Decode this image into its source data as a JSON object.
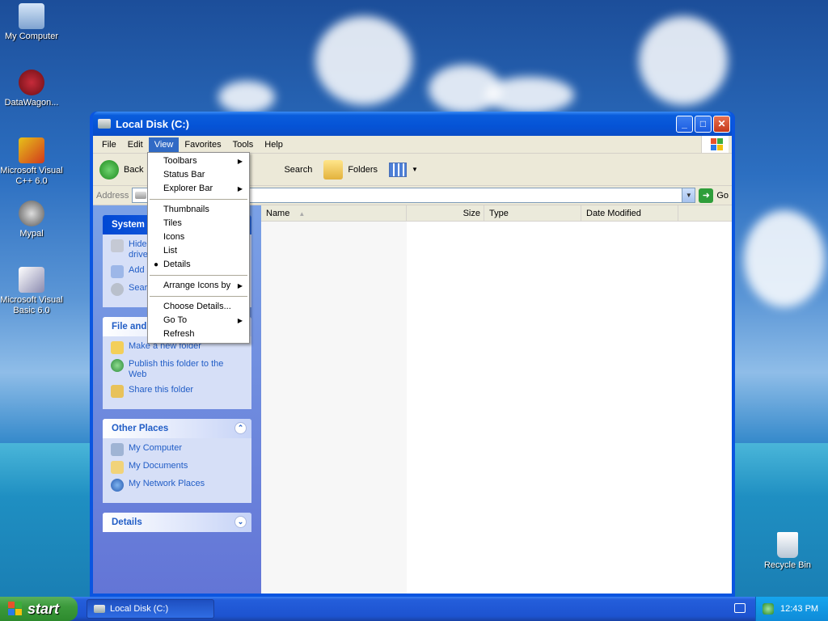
{
  "desktop": {
    "icons": [
      {
        "label": "My Computer",
        "icon": "my-computer-icon"
      },
      {
        "label": "DataWagon...",
        "icon": "datawagon-icon"
      },
      {
        "label": "Microsoft Visual C++ 6.0",
        "icon": "visual-cpp-icon"
      },
      {
        "label": "Mypal",
        "icon": "mypal-icon"
      },
      {
        "label": "Microsoft Visual Basic 6.0",
        "icon": "visual-basic-icon"
      },
      {
        "label": "Recycle Bin",
        "icon": "recycle-bin-icon"
      }
    ]
  },
  "window": {
    "title": "Local Disk (C:)",
    "menu": [
      "File",
      "Edit",
      "View",
      "Favorites",
      "Tools",
      "Help"
    ],
    "toolbar": {
      "back": "Back",
      "search": "Search",
      "folders": "Folders"
    },
    "address": {
      "label": "Address",
      "value": "",
      "go": "Go"
    },
    "view_menu": {
      "toolbars": "Toolbars",
      "status_bar": "Status Bar",
      "explorer_bar": "Explorer Bar",
      "thumbnails": "Thumbnails",
      "tiles": "Tiles",
      "icons": "Icons",
      "list": "List",
      "details": "Details",
      "arrange_icons_by": "Arrange Icons by",
      "choose_details": "Choose Details...",
      "go_to": "Go To",
      "refresh": "Refresh"
    },
    "taskpane": {
      "system_tasks": {
        "title": "System Tasks",
        "items": [
          "Hide the contents of this drive",
          "Add or remove programs",
          "Search for files or folders"
        ]
      },
      "file_folder_tasks": {
        "title": "File and Folder Tasks",
        "items": [
          "Make a new folder",
          "Publish this folder to the Web",
          "Share this folder"
        ]
      },
      "other_places": {
        "title": "Other Places",
        "items": [
          "My Computer",
          "My Documents",
          "My Network Places"
        ]
      },
      "details": {
        "title": "Details"
      }
    },
    "columns": [
      "Name",
      "Size",
      "Type",
      "Date Modified"
    ]
  },
  "taskbar": {
    "start": "start",
    "task_button": "Local Disk (C:)",
    "clock": "12:43 PM"
  },
  "colors": {
    "xp_blue": "#0a55e0",
    "menu_highlight": "#316ac5",
    "start_green": "#3c9a3c",
    "task_link": "#215dc6"
  }
}
